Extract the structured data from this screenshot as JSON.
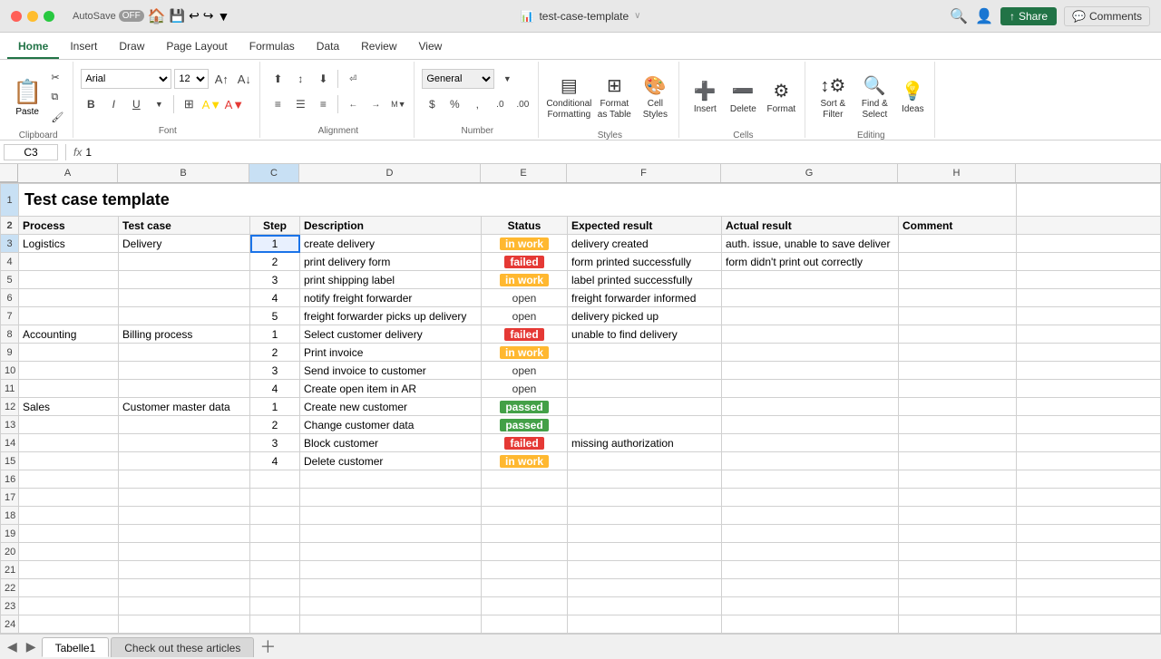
{
  "titlebar": {
    "filename": "test-case-template",
    "autosave_label": "AutoSave",
    "autosave_state": "OFF"
  },
  "ribbon": {
    "tabs": [
      "Home",
      "Insert",
      "Draw",
      "Page Layout",
      "Formulas",
      "Data",
      "Review",
      "View"
    ],
    "active_tab": "Home",
    "share_label": "Share",
    "comments_label": "Comments"
  },
  "toolbar": {
    "font_family": "Arial",
    "font_size": "12",
    "wrap_text": "Wrap Text",
    "number_format": "General",
    "merge_center": "Merge & Center",
    "paste_label": "Paste",
    "conditional_formatting": "Conditional\nFormatting",
    "format_as_table": "Format\nas Table",
    "cell_styles": "Cell\nStyles",
    "insert_label": "Insert",
    "delete_label": "Delete",
    "format_label": "Format",
    "sort_filter": "Sort &\nFilter",
    "find_select": "Find &\nSelect",
    "ideas_label": "Ideas"
  },
  "formula_bar": {
    "cell_ref": "C3",
    "formula": "1",
    "fx_symbol": "fx"
  },
  "columns": {
    "headers": [
      "",
      "A",
      "B",
      "C",
      "D",
      "E",
      "F",
      "G",
      "H"
    ],
    "widths": [
      20,
      110,
      145,
      55,
      200,
      95,
      170,
      195,
      130
    ]
  },
  "rows": [
    {
      "num": "1",
      "cells": [
        {
          "col": "A",
          "val": "Test case template",
          "colspan": 8,
          "style": "title"
        }
      ]
    },
    {
      "num": "2",
      "cells": [
        {
          "col": "A",
          "val": "Process"
        },
        {
          "col": "B",
          "val": "Test case"
        },
        {
          "col": "C",
          "val": "Step"
        },
        {
          "col": "D",
          "val": "Description"
        },
        {
          "col": "E",
          "val": "Status"
        },
        {
          "col": "F",
          "val": "Expected result"
        },
        {
          "col": "G",
          "val": "Actual result"
        },
        {
          "col": "H",
          "val": "Comment"
        }
      ]
    },
    {
      "num": "3",
      "cells": [
        {
          "col": "A",
          "val": "Logistics"
        },
        {
          "col": "B",
          "val": "Delivery"
        },
        {
          "col": "C",
          "val": "1",
          "selected": true
        },
        {
          "col": "D",
          "val": "create delivery"
        },
        {
          "col": "E",
          "val": "in work",
          "status": "in-work"
        },
        {
          "col": "F",
          "val": "delivery created"
        },
        {
          "col": "G",
          "val": "auth. issue, unable to save deliver"
        },
        {
          "col": "H",
          "val": ""
        }
      ]
    },
    {
      "num": "4",
      "cells": [
        {
          "col": "A",
          "val": ""
        },
        {
          "col": "B",
          "val": ""
        },
        {
          "col": "C",
          "val": "2"
        },
        {
          "col": "D",
          "val": "print delivery form"
        },
        {
          "col": "E",
          "val": "failed",
          "status": "failed"
        },
        {
          "col": "F",
          "val": "form printed successfully"
        },
        {
          "col": "G",
          "val": "form didn't print out correctly"
        },
        {
          "col": "H",
          "val": ""
        }
      ]
    },
    {
      "num": "5",
      "cells": [
        {
          "col": "A",
          "val": ""
        },
        {
          "col": "B",
          "val": ""
        },
        {
          "col": "C",
          "val": "3"
        },
        {
          "col": "D",
          "val": "print shipping label"
        },
        {
          "col": "E",
          "val": "in work",
          "status": "in-work"
        },
        {
          "col": "F",
          "val": "label printed successfully"
        },
        {
          "col": "G",
          "val": ""
        },
        {
          "col": "H",
          "val": ""
        }
      ]
    },
    {
      "num": "6",
      "cells": [
        {
          "col": "A",
          "val": ""
        },
        {
          "col": "B",
          "val": ""
        },
        {
          "col": "C",
          "val": "4"
        },
        {
          "col": "D",
          "val": "notify freight forwarder"
        },
        {
          "col": "E",
          "val": "open",
          "status": "open"
        },
        {
          "col": "F",
          "val": "freight forwarder informed"
        },
        {
          "col": "G",
          "val": ""
        },
        {
          "col": "H",
          "val": ""
        }
      ]
    },
    {
      "num": "7",
      "cells": [
        {
          "col": "A",
          "val": ""
        },
        {
          "col": "B",
          "val": ""
        },
        {
          "col": "C",
          "val": "5"
        },
        {
          "col": "D",
          "val": "freight forwarder picks up delivery"
        },
        {
          "col": "E",
          "val": "open",
          "status": "open"
        },
        {
          "col": "F",
          "val": "delivery picked up"
        },
        {
          "col": "G",
          "val": ""
        },
        {
          "col": "H",
          "val": ""
        }
      ]
    },
    {
      "num": "8",
      "cells": [
        {
          "col": "A",
          "val": "Accounting"
        },
        {
          "col": "B",
          "val": "Billing process"
        },
        {
          "col": "C",
          "val": "1"
        },
        {
          "col": "D",
          "val": "Select customer delivery"
        },
        {
          "col": "E",
          "val": "failed",
          "status": "failed"
        },
        {
          "col": "F",
          "val": "unable to find delivery"
        },
        {
          "col": "G",
          "val": ""
        },
        {
          "col": "H",
          "val": ""
        }
      ]
    },
    {
      "num": "9",
      "cells": [
        {
          "col": "A",
          "val": ""
        },
        {
          "col": "B",
          "val": ""
        },
        {
          "col": "C",
          "val": "2"
        },
        {
          "col": "D",
          "val": "Print invoice"
        },
        {
          "col": "E",
          "val": "in work",
          "status": "in-work"
        },
        {
          "col": "F",
          "val": ""
        },
        {
          "col": "G",
          "val": ""
        },
        {
          "col": "H",
          "val": ""
        }
      ]
    },
    {
      "num": "10",
      "cells": [
        {
          "col": "A",
          "val": ""
        },
        {
          "col": "B",
          "val": ""
        },
        {
          "col": "C",
          "val": "3"
        },
        {
          "col": "D",
          "val": "Send invoice to customer"
        },
        {
          "col": "E",
          "val": "open",
          "status": "open"
        },
        {
          "col": "F",
          "val": ""
        },
        {
          "col": "G",
          "val": ""
        },
        {
          "col": "H",
          "val": ""
        }
      ]
    },
    {
      "num": "11",
      "cells": [
        {
          "col": "A",
          "val": ""
        },
        {
          "col": "B",
          "val": ""
        },
        {
          "col": "C",
          "val": "4"
        },
        {
          "col": "D",
          "val": "Create open item in AR"
        },
        {
          "col": "E",
          "val": "open",
          "status": "open"
        },
        {
          "col": "F",
          "val": ""
        },
        {
          "col": "G",
          "val": ""
        },
        {
          "col": "H",
          "val": ""
        }
      ]
    },
    {
      "num": "12",
      "cells": [
        {
          "col": "A",
          "val": "Sales"
        },
        {
          "col": "B",
          "val": "Customer master data"
        },
        {
          "col": "C",
          "val": "1"
        },
        {
          "col": "D",
          "val": "Create new customer"
        },
        {
          "col": "E",
          "val": "passed",
          "status": "passed"
        },
        {
          "col": "F",
          "val": ""
        },
        {
          "col": "G",
          "val": ""
        },
        {
          "col": "H",
          "val": ""
        }
      ]
    },
    {
      "num": "13",
      "cells": [
        {
          "col": "A",
          "val": ""
        },
        {
          "col": "B",
          "val": ""
        },
        {
          "col": "C",
          "val": "2"
        },
        {
          "col": "D",
          "val": "Change customer data"
        },
        {
          "col": "E",
          "val": "passed",
          "status": "passed"
        },
        {
          "col": "F",
          "val": ""
        },
        {
          "col": "G",
          "val": ""
        },
        {
          "col": "H",
          "val": ""
        }
      ]
    },
    {
      "num": "14",
      "cells": [
        {
          "col": "A",
          "val": ""
        },
        {
          "col": "B",
          "val": ""
        },
        {
          "col": "C",
          "val": "3"
        },
        {
          "col": "D",
          "val": "Block customer"
        },
        {
          "col": "E",
          "val": "failed",
          "status": "failed"
        },
        {
          "col": "F",
          "val": "missing authorization"
        },
        {
          "col": "G",
          "val": ""
        },
        {
          "col": "H",
          "val": ""
        }
      ]
    },
    {
      "num": "15",
      "cells": [
        {
          "col": "A",
          "val": ""
        },
        {
          "col": "B",
          "val": ""
        },
        {
          "col": "C",
          "val": "4"
        },
        {
          "col": "D",
          "val": "Delete customer"
        },
        {
          "col": "E",
          "val": "in work",
          "status": "in-work"
        },
        {
          "col": "F",
          "val": ""
        },
        {
          "col": "G",
          "val": ""
        },
        {
          "col": "H",
          "val": ""
        }
      ]
    },
    {
      "num": "16",
      "cells": [
        {
          "col": "A",
          "val": ""
        },
        {
          "col": "B",
          "val": ""
        },
        {
          "col": "C",
          "val": ""
        },
        {
          "col": "D",
          "val": ""
        },
        {
          "col": "E",
          "val": ""
        },
        {
          "col": "F",
          "val": ""
        },
        {
          "col": "G",
          "val": ""
        },
        {
          "col": "H",
          "val": ""
        }
      ]
    },
    {
      "num": "17",
      "cells": [
        {
          "col": "A",
          "val": ""
        },
        {
          "col": "B",
          "val": ""
        },
        {
          "col": "C",
          "val": ""
        },
        {
          "col": "D",
          "val": ""
        },
        {
          "col": "E",
          "val": ""
        },
        {
          "col": "F",
          "val": ""
        },
        {
          "col": "G",
          "val": ""
        },
        {
          "col": "H",
          "val": ""
        }
      ]
    },
    {
      "num": "18",
      "cells": [
        {
          "col": "A",
          "val": ""
        },
        {
          "col": "B",
          "val": ""
        },
        {
          "col": "C",
          "val": ""
        },
        {
          "col": "D",
          "val": ""
        },
        {
          "col": "E",
          "val": ""
        },
        {
          "col": "F",
          "val": ""
        },
        {
          "col": "G",
          "val": ""
        },
        {
          "col": "H",
          "val": ""
        }
      ]
    },
    {
      "num": "19",
      "cells": [
        {
          "col": "A",
          "val": ""
        },
        {
          "col": "B",
          "val": ""
        },
        {
          "col": "C",
          "val": ""
        },
        {
          "col": "D",
          "val": ""
        },
        {
          "col": "E",
          "val": ""
        },
        {
          "col": "F",
          "val": ""
        },
        {
          "col": "G",
          "val": ""
        },
        {
          "col": "H",
          "val": ""
        }
      ]
    },
    {
      "num": "20",
      "cells": [
        {
          "col": "A",
          "val": ""
        },
        {
          "col": "B",
          "val": ""
        },
        {
          "col": "C",
          "val": ""
        },
        {
          "col": "D",
          "val": ""
        },
        {
          "col": "E",
          "val": ""
        },
        {
          "col": "F",
          "val": ""
        },
        {
          "col": "G",
          "val": ""
        },
        {
          "col": "H",
          "val": ""
        }
      ]
    },
    {
      "num": "21",
      "cells": [
        {
          "col": "A",
          "val": ""
        },
        {
          "col": "B",
          "val": ""
        },
        {
          "col": "C",
          "val": ""
        },
        {
          "col": "D",
          "val": ""
        },
        {
          "col": "E",
          "val": ""
        },
        {
          "col": "F",
          "val": ""
        },
        {
          "col": "G",
          "val": ""
        },
        {
          "col": "H",
          "val": ""
        }
      ]
    },
    {
      "num": "22",
      "cells": [
        {
          "col": "A",
          "val": ""
        },
        {
          "col": "B",
          "val": ""
        },
        {
          "col": "C",
          "val": ""
        },
        {
          "col": "D",
          "val": ""
        },
        {
          "col": "E",
          "val": ""
        },
        {
          "col": "F",
          "val": ""
        },
        {
          "col": "G",
          "val": ""
        },
        {
          "col": "H",
          "val": ""
        }
      ]
    },
    {
      "num": "23",
      "cells": [
        {
          "col": "A",
          "val": ""
        },
        {
          "col": "B",
          "val": ""
        },
        {
          "col": "C",
          "val": ""
        },
        {
          "col": "D",
          "val": ""
        },
        {
          "col": "E",
          "val": ""
        },
        {
          "col": "F",
          "val": ""
        },
        {
          "col": "G",
          "val": ""
        },
        {
          "col": "H",
          "val": ""
        }
      ]
    },
    {
      "num": "24",
      "cells": [
        {
          "col": "A",
          "val": ""
        },
        {
          "col": "B",
          "val": ""
        },
        {
          "col": "C",
          "val": ""
        },
        {
          "col": "D",
          "val": ""
        },
        {
          "col": "E",
          "val": ""
        },
        {
          "col": "F",
          "val": ""
        },
        {
          "col": "G",
          "val": ""
        },
        {
          "col": "H",
          "val": ""
        }
      ]
    }
  ],
  "sheet_tabs": {
    "tabs": [
      "Tabelle1",
      "Check out these articles"
    ],
    "active": "Tabelle1"
  }
}
